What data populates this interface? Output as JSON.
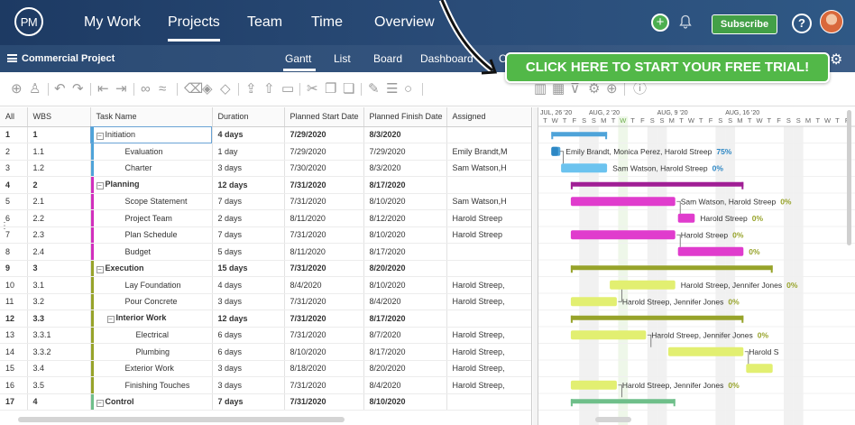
{
  "nav": {
    "logo": "PM",
    "items": [
      "My Work",
      "Projects",
      "Team",
      "Time",
      "Overview"
    ],
    "active": "Projects",
    "subscribe": "Subscribe",
    "help": "?"
  },
  "subnav": {
    "project": "Commercial Project",
    "tabs": [
      "Gantt",
      "List",
      "Board",
      "Dashboard",
      "C"
    ],
    "active": "Gantt"
  },
  "cta": {
    "label": "CLICK HERE TO START YOUR FREE TRIAL!"
  },
  "colors": {
    "blue": "#4ea3d9",
    "magenta": "#d12fbd",
    "olive": "#97a32a",
    "lime": "#e2ef71",
    "green": "#6fbf8a",
    "accent": "#52b848"
  },
  "grid": {
    "columns": [
      "All",
      "WBS",
      "Task Name",
      "Duration",
      "Planned Start Date",
      "Planned Finish Date",
      "Assigned"
    ],
    "rows": [
      {
        "all": "1",
        "wbs": "1",
        "name": "Initiation",
        "duration": "4 days",
        "start": "7/29/2020",
        "finish": "8/3/2020",
        "assigned": "",
        "group": true,
        "level": 0,
        "color": "#4ea3d9"
      },
      {
        "all": "2",
        "wbs": "1.1",
        "name": "Evaluation",
        "duration": "1 day",
        "start": "7/29/2020",
        "finish": "7/29/2020",
        "assigned": "Emily Brandt,M",
        "group": false,
        "level": 1,
        "color": "#4ea3d9"
      },
      {
        "all": "3",
        "wbs": "1.2",
        "name": "Charter",
        "duration": "3 days",
        "start": "7/30/2020",
        "finish": "8/3/2020",
        "assigned": "Sam Watson,H",
        "group": false,
        "level": 1,
        "color": "#4ea3d9"
      },
      {
        "all": "4",
        "wbs": "2",
        "name": "Planning",
        "duration": "12 days",
        "start": "7/31/2020",
        "finish": "8/17/2020",
        "assigned": "",
        "group": true,
        "level": 0,
        "color": "#d12fbd"
      },
      {
        "all": "5",
        "wbs": "2.1",
        "name": "Scope Statement",
        "duration": "7 days",
        "start": "7/31/2020",
        "finish": "8/10/2020",
        "assigned": "Sam Watson,H",
        "group": false,
        "level": 1,
        "color": "#d12fbd"
      },
      {
        "all": "6",
        "wbs": "2.2",
        "name": "Project Team",
        "duration": "2 days",
        "start": "8/11/2020",
        "finish": "8/12/2020",
        "assigned": "Harold Streep",
        "group": false,
        "level": 1,
        "color": "#d12fbd"
      },
      {
        "all": "7",
        "wbs": "2.3",
        "name": "Plan Schedule",
        "duration": "7 days",
        "start": "7/31/2020",
        "finish": "8/10/2020",
        "assigned": "Harold Streep",
        "group": false,
        "level": 1,
        "color": "#d12fbd"
      },
      {
        "all": "8",
        "wbs": "2.4",
        "name": "Budget",
        "duration": "5 days",
        "start": "8/11/2020",
        "finish": "8/17/2020",
        "assigned": "",
        "group": false,
        "level": 1,
        "color": "#d12fbd"
      },
      {
        "all": "9",
        "wbs": "3",
        "name": "Execution",
        "duration": "15 days",
        "start": "7/31/2020",
        "finish": "8/20/2020",
        "assigned": "",
        "group": true,
        "level": 0,
        "color": "#97a32a"
      },
      {
        "all": "10",
        "wbs": "3.1",
        "name": "Lay Foundation",
        "duration": "4 days",
        "start": "8/4/2020",
        "finish": "8/10/2020",
        "assigned": "Harold Streep,",
        "group": false,
        "level": 1,
        "color": "#97a32a"
      },
      {
        "all": "11",
        "wbs": "3.2",
        "name": "Pour Concrete",
        "duration": "3 days",
        "start": "7/31/2020",
        "finish": "8/4/2020",
        "assigned": "Harold Streep,",
        "group": false,
        "level": 1,
        "color": "#97a32a"
      },
      {
        "all": "12",
        "wbs": "3.3",
        "name": "Interior Work",
        "duration": "12 days",
        "start": "7/31/2020",
        "finish": "8/17/2020",
        "assigned": "",
        "group": true,
        "level": 1,
        "color": "#97a32a"
      },
      {
        "all": "13",
        "wbs": "3.3.1",
        "name": "Electrical",
        "duration": "6 days",
        "start": "7/31/2020",
        "finish": "8/7/2020",
        "assigned": "Harold Streep,",
        "group": false,
        "level": 2,
        "color": "#97a32a"
      },
      {
        "all": "14",
        "wbs": "3.3.2",
        "name": "Plumbing",
        "duration": "6 days",
        "start": "8/10/2020",
        "finish": "8/17/2020",
        "assigned": "Harold Streep,",
        "group": false,
        "level": 2,
        "color": "#97a32a"
      },
      {
        "all": "15",
        "wbs": "3.4",
        "name": "Exterior Work",
        "duration": "3 days",
        "start": "8/18/2020",
        "finish": "8/20/2020",
        "assigned": "Harold Streep,",
        "group": false,
        "level": 1,
        "color": "#97a32a"
      },
      {
        "all": "16",
        "wbs": "3.5",
        "name": "Finishing Touches",
        "duration": "3 days",
        "start": "7/31/2020",
        "finish": "8/4/2020",
        "assigned": "Harold Streep,",
        "group": false,
        "level": 1,
        "color": "#97a32a"
      },
      {
        "all": "17",
        "wbs": "4",
        "name": "Control",
        "duration": "7 days",
        "start": "7/31/2020",
        "finish": "8/10/2020",
        "assigned": "",
        "group": true,
        "level": 0,
        "color": "#6fbf8a"
      }
    ]
  },
  "gantt": {
    "weeks": [
      "JUL, 26 '20",
      "AUG, 2 '20",
      "AUG, 9 '20",
      "AUG, 16 '20"
    ],
    "day_letters": [
      "T",
      "W",
      "T",
      "F",
      "S",
      "S",
      "M",
      "T",
      "W",
      "T",
      "F",
      "S",
      "S",
      "M",
      "T",
      "W",
      "T",
      "F",
      "S",
      "S",
      "M",
      "T",
      "W",
      "T",
      "F",
      "S",
      "S",
      "M",
      "T",
      "W",
      "T",
      "F"
    ],
    "bars": [
      {
        "row": 0,
        "start": "7/29/2020",
        "end": "8/3/2020",
        "type": "summary",
        "color": "#4ea3d9",
        "label": "",
        "progress": null
      },
      {
        "row": 1,
        "start": "7/29/2020",
        "end": "7/29/2020",
        "type": "task",
        "color": "#4ea3d9",
        "label": "Emily Brandt, Monica Perez, Harold Streep",
        "progress": "75%"
      },
      {
        "row": 2,
        "start": "7/30/2020",
        "end": "8/3/2020",
        "type": "task",
        "color": "#6cc3ef",
        "label": "Sam Watson, Harold Streep",
        "progress": "0%"
      },
      {
        "row": 3,
        "start": "7/31/2020",
        "end": "8/17/2020",
        "type": "summary",
        "color": "#a01f95",
        "label": "",
        "progress": null
      },
      {
        "row": 4,
        "start": "7/31/2020",
        "end": "8/10/2020",
        "type": "task",
        "color": "#e03ccd",
        "label": "Sam Watson, Harold Streep",
        "progress": "0%"
      },
      {
        "row": 5,
        "start": "8/11/2020",
        "end": "8/12/2020",
        "type": "task",
        "color": "#e03ccd",
        "label": "Harold Streep",
        "progress": "0%"
      },
      {
        "row": 6,
        "start": "7/31/2020",
        "end": "8/10/2020",
        "type": "task",
        "color": "#e03ccd",
        "label": "Harold Streep",
        "progress": "0%"
      },
      {
        "row": 7,
        "start": "8/11/2020",
        "end": "8/17/2020",
        "type": "task",
        "color": "#e03ccd",
        "label": "",
        "progress": "0%"
      },
      {
        "row": 8,
        "start": "7/31/2020",
        "end": "8/20/2020",
        "type": "summary",
        "color": "#97a32a",
        "label": "",
        "progress": null
      },
      {
        "row": 9,
        "start": "8/4/2020",
        "end": "8/10/2020",
        "type": "task",
        "color": "#e2ef71",
        "label": "Harold Streep, Jennifer Jones",
        "progress": "0%"
      },
      {
        "row": 10,
        "start": "7/31/2020",
        "end": "8/4/2020",
        "type": "task",
        "color": "#e2ef71",
        "label": "Harold Streep, Jennifer Jones",
        "progress": "0%"
      },
      {
        "row": 11,
        "start": "7/31/2020",
        "end": "8/17/2020",
        "type": "summary",
        "color": "#97a32a",
        "label": "",
        "progress": null
      },
      {
        "row": 12,
        "start": "7/31/2020",
        "end": "8/7/2020",
        "type": "task",
        "color": "#e2ef71",
        "label": "Harold Streep, Jennifer Jones",
        "progress": "0%"
      },
      {
        "row": 13,
        "start": "8/10/2020",
        "end": "8/17/2020",
        "type": "task",
        "color": "#e2ef71",
        "label": "Harold S",
        "progress": null
      },
      {
        "row": 14,
        "start": "8/18/2020",
        "end": "8/20/2020",
        "type": "task",
        "color": "#e2ef71",
        "label": "",
        "progress": null
      },
      {
        "row": 15,
        "start": "7/31/2020",
        "end": "8/4/2020",
        "type": "task",
        "color": "#e2ef71",
        "label": "Harold Streep, Jennifer Jones",
        "progress": "0%"
      },
      {
        "row": 16,
        "start": "7/31/2020",
        "end": "8/10/2020",
        "type": "summary",
        "color": "#6fbf8a",
        "label": "",
        "progress": null
      }
    ]
  }
}
